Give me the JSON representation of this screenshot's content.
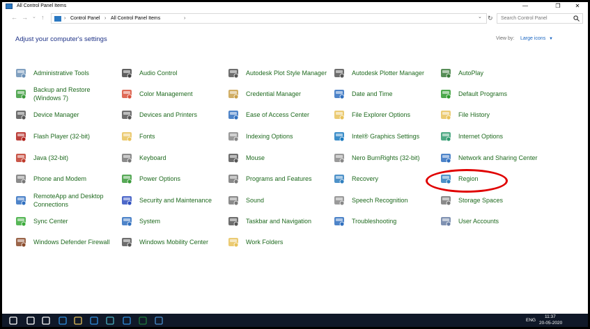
{
  "window": {
    "title": "All Control Panel Items",
    "minimize": "—",
    "maximize": "❐",
    "close": "✕"
  },
  "nav": {
    "back": "←",
    "forward": "→",
    "dropdown": "⌄",
    "up": "↑"
  },
  "address": {
    "crumbs": [
      "Control Panel",
      "All Control Panel Items"
    ],
    "separator": "›",
    "dropdown": "⌄",
    "refresh": "↻"
  },
  "search": {
    "placeholder": "Search Control Panel"
  },
  "heading": "Adjust your computer's settings",
  "view_by": {
    "label": "View by:",
    "value": "Large icons",
    "arrow": "▼"
  },
  "items": [
    {
      "label": "Administrative Tools",
      "icon": "tools-icon",
      "color": "#6a8fb5"
    },
    {
      "label": "Audio Control",
      "icon": "audio-icon",
      "color": "#444444"
    },
    {
      "label": "Autodesk Plot Style Manager",
      "icon": "printer-icon",
      "color": "#555555"
    },
    {
      "label": "Autodesk Plotter Manager",
      "icon": "plotter-icon",
      "color": "#555555"
    },
    {
      "label": "AutoPlay",
      "icon": "autoplay-icon",
      "color": "#3a7a3a"
    },
    {
      "label": "Backup and Restore (Windows 7)",
      "icon": "backup-icon",
      "color": "#3a9a3a"
    },
    {
      "label": "Color Management",
      "icon": "color-icon",
      "color": "#d9503a"
    },
    {
      "label": "Credential Manager",
      "icon": "credential-icon",
      "color": "#c9a04a"
    },
    {
      "label": "Date and Time",
      "icon": "datetime-icon",
      "color": "#2f6fbf"
    },
    {
      "label": "Default Programs",
      "icon": "default-programs-icon",
      "color": "#2f9a2f"
    },
    {
      "label": "Device Manager",
      "icon": "device-manager-icon",
      "color": "#555555"
    },
    {
      "label": "Devices and Printers",
      "icon": "devices-icon",
      "color": "#555555"
    },
    {
      "label": "Ease of Access Center",
      "icon": "ease-of-access-icon",
      "color": "#2f6fbf"
    },
    {
      "label": "File Explorer Options",
      "icon": "folder-options-icon",
      "color": "#e8c25a"
    },
    {
      "label": "File History",
      "icon": "file-history-icon",
      "color": "#e8c25a"
    },
    {
      "label": "Flash Player (32-bit)",
      "icon": "flash-icon",
      "color": "#b0201a"
    },
    {
      "label": "Fonts",
      "icon": "fonts-icon",
      "color": "#e8c25a"
    },
    {
      "label": "Indexing Options",
      "icon": "indexing-icon",
      "color": "#888888"
    },
    {
      "label": "Intel® Graphics Settings",
      "icon": "intel-icon",
      "color": "#1a7abf"
    },
    {
      "label": "Internet Options",
      "icon": "internet-icon",
      "color": "#2f9a6f"
    },
    {
      "label": "Java (32-bit)",
      "icon": "java-icon",
      "color": "#c03a2a"
    },
    {
      "label": "Keyboard",
      "icon": "keyboard-icon",
      "color": "#777777"
    },
    {
      "label": "Mouse",
      "icon": "mouse-icon",
      "color": "#555555"
    },
    {
      "label": "Nero BurnRights (32-bit)",
      "icon": "nero-icon",
      "color": "#888888"
    },
    {
      "label": "Network and Sharing Center",
      "icon": "network-icon",
      "color": "#2f6fbf"
    },
    {
      "label": "Phone and Modem",
      "icon": "phone-icon",
      "color": "#777777"
    },
    {
      "label": "Power Options",
      "icon": "power-icon",
      "color": "#3a9a3a"
    },
    {
      "label": "Programs and Features",
      "icon": "programs-icon",
      "color": "#777777"
    },
    {
      "label": "Recovery",
      "icon": "recovery-icon",
      "color": "#2f7fbf"
    },
    {
      "label": "Region",
      "icon": "region-icon",
      "color": "#2f7fbf"
    },
    {
      "label": "RemoteApp and Desktop Connections",
      "icon": "remoteapp-icon",
      "color": "#2f6fbf"
    },
    {
      "label": "Security and Maintenance",
      "icon": "security-flag-icon",
      "color": "#2f4fbf"
    },
    {
      "label": "Sound",
      "icon": "sound-icon",
      "color": "#777777"
    },
    {
      "label": "Speech Recognition",
      "icon": "microphone-icon",
      "color": "#888888"
    },
    {
      "label": "Storage Spaces",
      "icon": "storage-icon",
      "color": "#777777"
    },
    {
      "label": "Sync Center",
      "icon": "sync-icon",
      "color": "#3aaa3a"
    },
    {
      "label": "System",
      "icon": "system-icon",
      "color": "#2f6fbf"
    },
    {
      "label": "Taskbar and Navigation",
      "icon": "taskbar-icon",
      "color": "#555555"
    },
    {
      "label": "Troubleshooting",
      "icon": "troubleshooting-icon",
      "color": "#2f6fbf"
    },
    {
      "label": "User Accounts",
      "icon": "user-accounts-icon",
      "color": "#6a7fa5"
    },
    {
      "label": "Windows Defender Firewall",
      "icon": "firewall-icon",
      "color": "#8a4a2a"
    },
    {
      "label": "Windows Mobility Center",
      "icon": "mobility-icon",
      "color": "#555555"
    },
    {
      "label": "Work Folders",
      "icon": "work-folders-icon",
      "color": "#e8c25a"
    }
  ],
  "taskbar": {
    "apps": [
      "start-icon",
      "search-icon",
      "task-view-icon",
      "edge-icon",
      "file-explorer-icon",
      "store-icon",
      "app-icon",
      "mail-icon",
      "excel-icon",
      "control-panel-icon"
    ],
    "language": "ENG",
    "time": "11:37",
    "date": "20-05-2020"
  },
  "colors": {
    "link": "#1f6a1f",
    "heading": "#1e3287",
    "highlight": "#e00000",
    "taskbar": "#101828"
  }
}
